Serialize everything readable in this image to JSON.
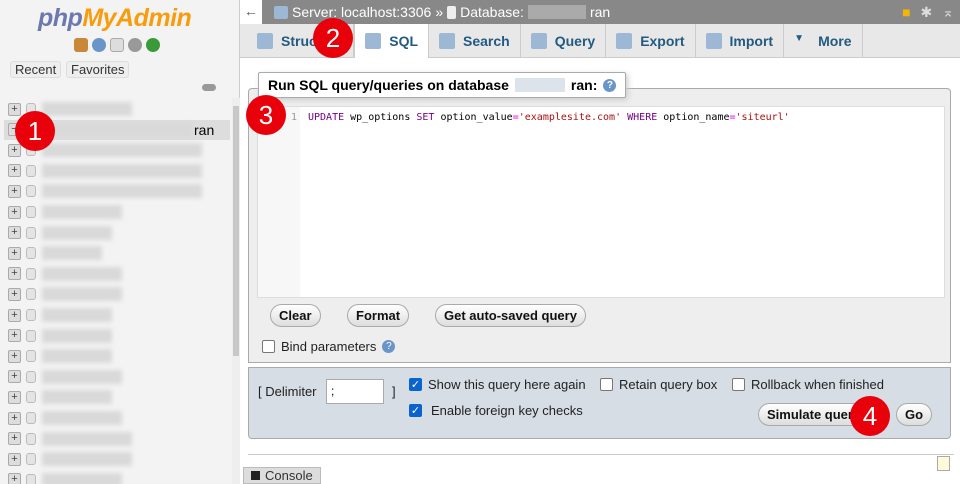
{
  "sidebar": {
    "logo_php": "php",
    "logo_my": "MyAdmin",
    "recent": "Recent",
    "favorites": "Favorites",
    "selected_db_suffix": "ran"
  },
  "topbar": {
    "server": "Server: localhost:3306",
    "sep": "»",
    "database_label": "Database:",
    "database_suffix": "ran"
  },
  "tabs": [
    {
      "label": "Structure",
      "icon": "structure-icon"
    },
    {
      "label": "SQL",
      "icon": "sql-icon",
      "active": true
    },
    {
      "label": "Search",
      "icon": "search-icon"
    },
    {
      "label": "Query",
      "icon": "query-icon"
    },
    {
      "label": "Export",
      "icon": "export-icon"
    },
    {
      "label": "Import",
      "icon": "import-icon"
    },
    {
      "label": "More",
      "icon": "caret-down-icon"
    }
  ],
  "sql": {
    "legend": "Run SQL query/queries on database",
    "legend_suffix": "ran:",
    "line_no": "1",
    "code": {
      "k1": "UPDATE",
      "t1": " wp_options ",
      "k2": "SET",
      "t2": " option_value",
      "eq": "=",
      "s1": "'examplesite.com'",
      "k3": " WHERE",
      "t3": " option_name",
      "s2": "'siteurl'"
    },
    "clear": "Clear",
    "format": "Format",
    "autosaved": "Get auto-saved query",
    "bind_params": "Bind parameters"
  },
  "options": {
    "delimiter_label": "[ Delimiter",
    "delimiter_value": ";",
    "delimiter_close": "]",
    "show_again": "Show this query here again",
    "retain": "Retain query box",
    "rollback": "Rollback when finished",
    "fk_checks": "Enable foreign key checks",
    "simulate": "Simulate query",
    "go": "Go"
  },
  "console": "Console",
  "badges": [
    "1",
    "2",
    "3",
    "4"
  ],
  "colors": {
    "badge": "#e8000a",
    "link": "#235a81"
  }
}
